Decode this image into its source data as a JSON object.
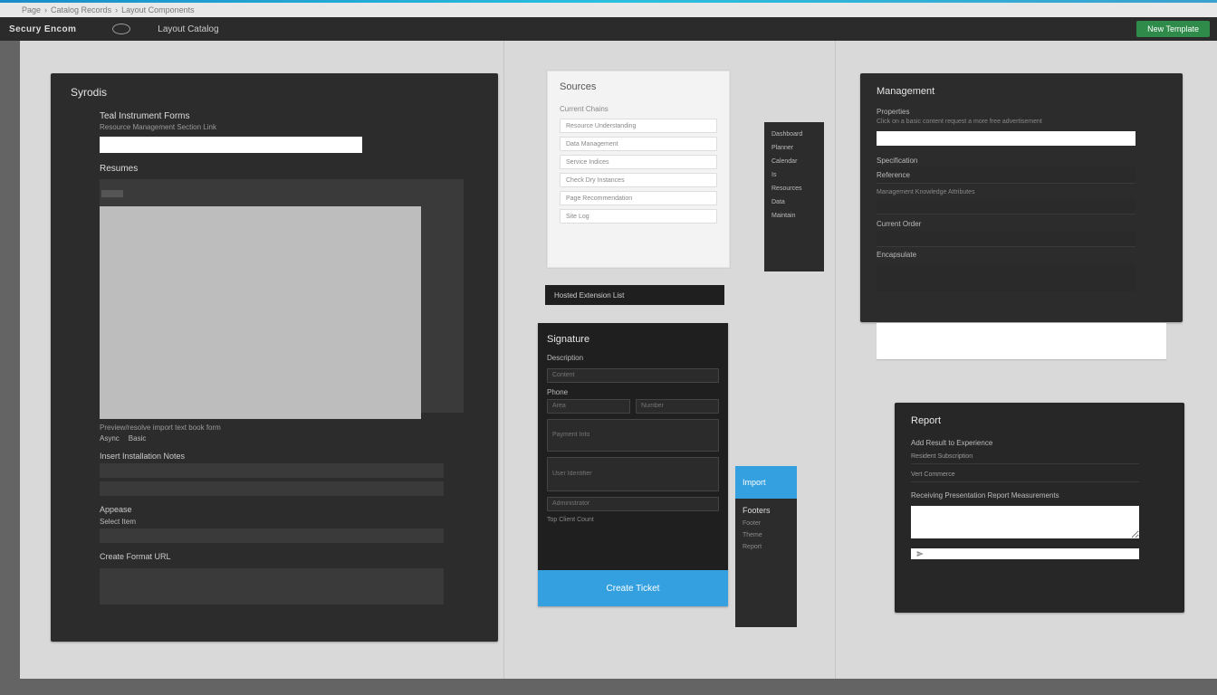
{
  "breadcrumb": {
    "a": "Page",
    "b": "Catalog Records",
    "c": "Layout Components"
  },
  "toolbar": {
    "brand": "Secury Encom",
    "secondary": "Layout Catalog",
    "primary_btn": "New Template"
  },
  "p1": {
    "title": "Syrodis",
    "subhead": "Teal Instrument Forms",
    "caption": "Resource Management Section Link",
    "input_val": "",
    "list_label": "Resumes",
    "img_hint": "Preview/resolve import text book form",
    "small_a": "Async",
    "small_b": "Basic",
    "row1": "Insert Installation Notes",
    "row2_label": "Appease",
    "row2_small": "Select Item",
    "row3": "Create Format URL",
    "code_caption": ""
  },
  "p2": {
    "title": "Sources",
    "group": "Current Chains",
    "items": [
      "Resource Understanding",
      "Data Management",
      "Service Indices",
      "Check Dry Instances",
      "Page Recommendation",
      "Site Log"
    ]
  },
  "nav1": [
    "Dashboard",
    "Planner",
    "Calendar",
    "Is",
    "Resources",
    "Data",
    "Maintain"
  ],
  "bar1": "Hosted Extension List",
  "p3": {
    "title": "Signature",
    "lbl1": "Description",
    "ph1": "Content",
    "lbl2": "Phone",
    "ph2a": "Area",
    "ph2b": "Number",
    "ph3": "Payment Info",
    "ph4": "User Identifier",
    "ph5": "Administrator",
    "foot": "Top Client Count",
    "cta": "Create Ticket"
  },
  "nav2": {
    "header": "Import",
    "group": "Footers",
    "items": [
      "Footer",
      "Theme",
      "Report"
    ]
  },
  "p4": {
    "title": "Management",
    "lbl1": "Properties",
    "sub1": "Click on a basic content request a more free advertisement",
    "in1": "",
    "lbl2": "Specification",
    "row1": "Reference",
    "sub2": "Management Knowledge Attributes",
    "lbl3": "Current Order",
    "lbl4": "Encapsulate"
  },
  "p5": {
    "title": "Report",
    "lbl1": "Add Result to Experience",
    "line1": "Resident Subscription",
    "line2": "Vert Commerce",
    "lbl2": "Receiving Presentation Report Measurements"
  }
}
